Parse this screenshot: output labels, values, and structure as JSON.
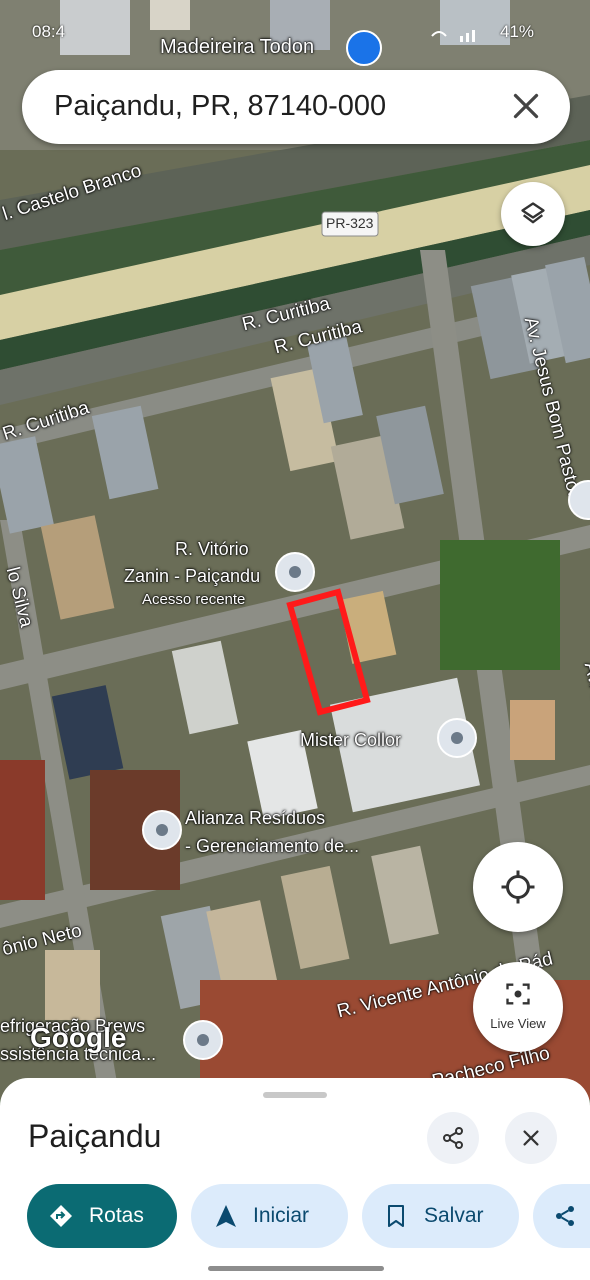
{
  "status_bar": {
    "time": "08:4",
    "battery": "41%"
  },
  "search": {
    "query": "Paiçandu, PR, 87140-000",
    "clear_icon": "close-icon"
  },
  "map": {
    "top_place": "Madeireira Todon",
    "streets": [
      "l. Castelo Branco",
      "PR-323",
      "R. Curitiba",
      "R. Curitiba",
      "R. Curitiba",
      "Av. Jesus Bom Pastor",
      "Av. Jesus Bom",
      "lo Silva",
      "ônio Neto",
      "R. Vicente Antônio de Pád",
      "Pacheco Filho"
    ],
    "pois": [
      {
        "name": "R. Vitório",
        "name2": "Zanin - Paiçandu",
        "sub": "Acesso recente"
      },
      {
        "name": "Mister Collor"
      },
      {
        "name": "Alianza Resíduos",
        "name2": "- Gerenciamento de..."
      },
      {
        "name": "efrigeração Brews",
        "name2": "ssistência técnica..."
      }
    ],
    "watermark": "Google",
    "layers_icon": "layers-icon",
    "location_icon": "my-location-icon",
    "live_view_label": "Live View"
  },
  "sheet": {
    "title": "Paiçandu",
    "share_icon": "share-icon",
    "close_icon": "close-icon",
    "chips": [
      {
        "label": "Rotas",
        "icon": "directions-icon",
        "primary": true
      },
      {
        "label": "Iniciar",
        "icon": "navigation-arrow-icon"
      },
      {
        "label": "Salvar",
        "icon": "bookmark-icon"
      },
      {
        "label": "",
        "icon": "share-icon"
      }
    ]
  },
  "colors": {
    "accent": "#0b6b73",
    "chip_bg": "#dcebfb",
    "highlight": "#ff1a1a"
  }
}
